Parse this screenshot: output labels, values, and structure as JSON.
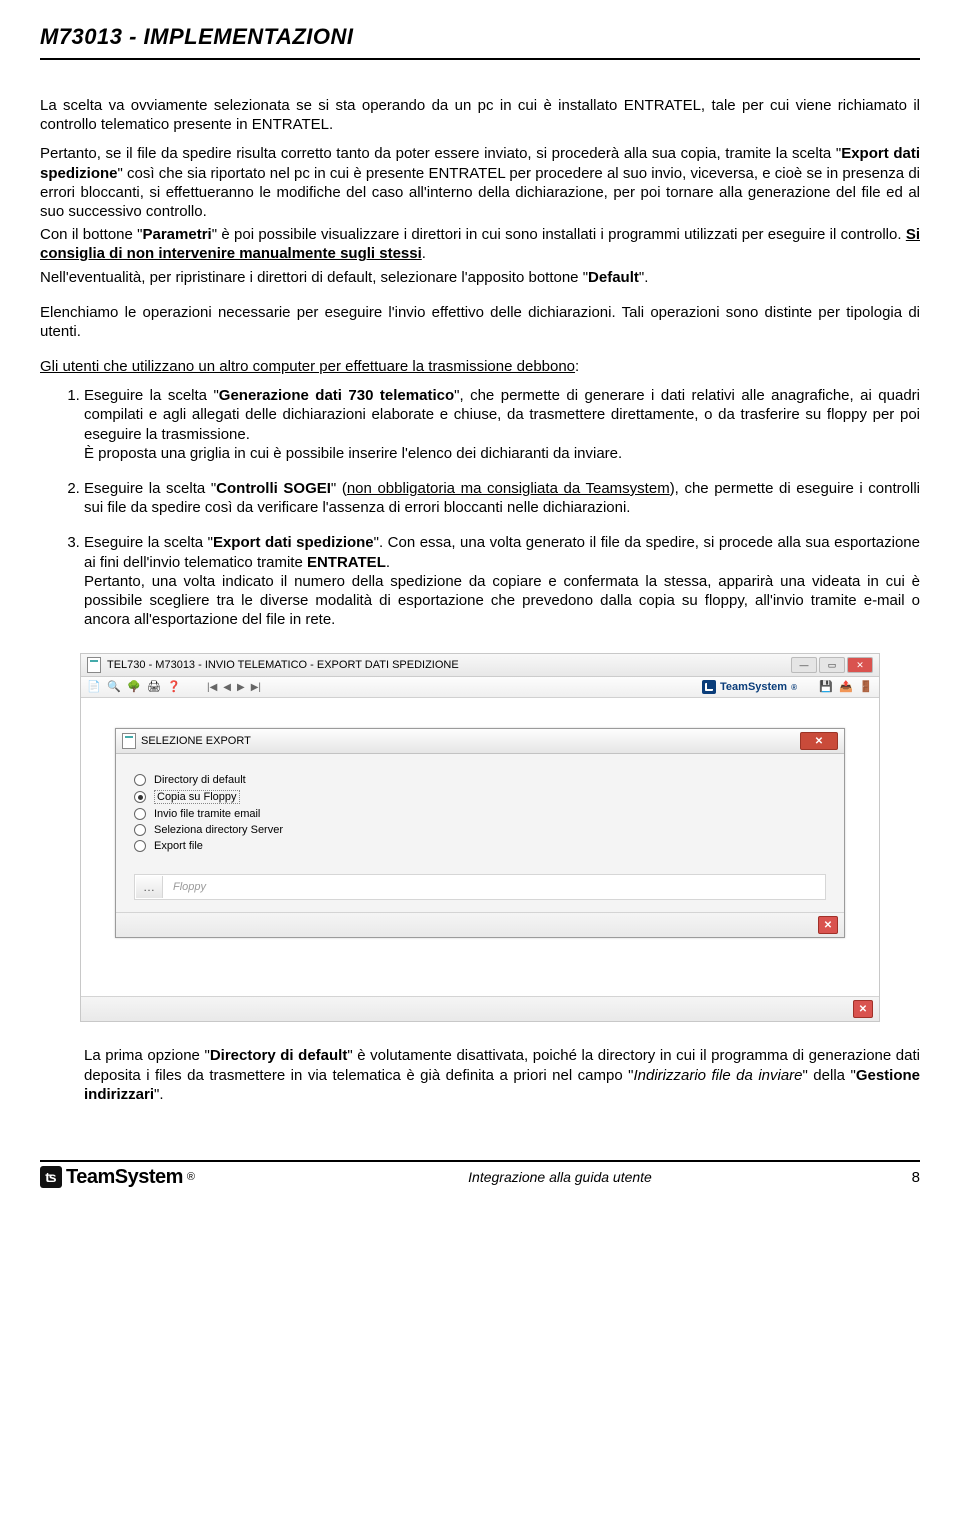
{
  "header": {
    "title": "M73013 - IMPLEMENTAZIONI"
  },
  "paragraphs": {
    "p1": "La scelta va ovviamente selezionata se si sta operando da un pc in cui è installato ENTRATEL, tale per cui viene richiamato il controllo telematico presente in ENTRATEL.",
    "p2a": "Pertanto, se il file da spedire risulta corretto tanto da poter essere inviato, si procederà alla sua copia, tramite la scelta \"",
    "p2b": "Export dati spedizione",
    "p2c": "\" così che sia riportato nel pc in cui è presente ENTRATEL per procedere al suo invio, viceversa, e cioè se in presenza di errori bloccanti, si effettueranno le modifiche del caso all'interno della dichiarazione, per poi tornare alla generazione del file ed al suo successivo controllo.",
    "p3a": "Con il bottone \"",
    "p3b": "Parametri",
    "p3c": "\" è poi possibile visualizzare i direttori in cui sono installati i programmi utilizzati per eseguire il controllo. ",
    "p3d": "Si consiglia di non intervenire manualmente sugli stessi",
    "p3e": ".",
    "p4a": "Nell'eventualità, per ripristinare i direttori di default, selezionare l'apposito bottone \"",
    "p4b": "Default",
    "p4c": "\".",
    "p5": "Elenchiamo le operazioni necessarie per eseguire l'invio effettivo delle dichiarazioni. Tali operazioni sono distinte per tipologia di utenti.",
    "p6": "Gli utenti che utilizzano un altro computer per effettuare la trasmissione debbono",
    "p6colon": ":"
  },
  "steps": {
    "s1a": "Eseguire la scelta \"",
    "s1b": "Generazione dati 730 telematico",
    "s1c": "\", che permette di generare i dati relativi alle anagrafiche, ai quadri compilati e agli allegati delle dichiarazioni elaborate e chiuse, da trasmettere direttamente, o da trasferire su floppy per poi eseguire la trasmissione.",
    "s1d": "È proposta una griglia in cui è possibile inserire l'elenco dei dichiaranti da inviare.",
    "s2a": "Eseguire la scelta \"",
    "s2b": "Controlli SOGEI",
    "s2c": "\" (",
    "s2d": "non obbligatoria ma consigliata da Teamsystem",
    "s2e": "), che permette di eseguire i controlli sui file da spedire così da verificare l'assenza di errori bloccanti nelle dichiarazioni.",
    "s3a": "Eseguire la scelta \"",
    "s3b": "Export dati spedizione",
    "s3c": "\". Con essa, una volta generato il file da spedire, si procede alla sua esportazione ai fini dell'invio telematico tramite ",
    "s3d": "ENTRATEL",
    "s3e": ".",
    "s3f": "Pertanto, una volta indicato il numero della spedizione da copiare e confermata la stessa, apparirà una videata in cui è possibile scegliere tra le diverse modalità di esportazione che prevedono dalla copia su floppy, all'invio tramite e-mail o ancora all'esportazione del file in rete."
  },
  "screenshot": {
    "window_title": "TEL730 - M73013 - INVIO TELEMATICO - EXPORT DATI SPEDIZIONE",
    "brand": "TeamSystem",
    "brand_reg": "®",
    "dialog_title": "SELEZIONE EXPORT",
    "radios": {
      "r1": "Directory di default",
      "r2": "Copia su Floppy",
      "r3": "Invio file tramite email",
      "r4": "Seleziona directory Server",
      "r5": "Export file"
    },
    "floppy_label": "Floppy"
  },
  "closing": {
    "c1a": "La prima opzione \"",
    "c1b": "Directory di default",
    "c1c": "\" è volutamente disattivata, poiché la directory in cui il programma di generazione dati deposita i files da trasmettere in via telematica è già definita a priori nel campo \"",
    "c1d": "Indirizzario file da inviare",
    "c1e": "\" della \"",
    "c1f": "Gestione indirizzari",
    "c1g": "\"."
  },
  "footer": {
    "brand_text": "TeamSystem",
    "brand_reg": "®",
    "center": "Integrazione alla guida utente",
    "page": "8"
  }
}
